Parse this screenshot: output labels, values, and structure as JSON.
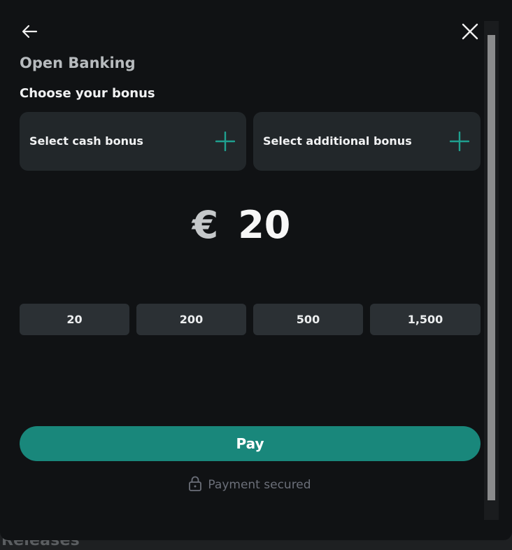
{
  "background": {
    "text": "Releases"
  },
  "modal": {
    "title": "Open Banking",
    "subtitle": "Choose your bonus",
    "bonus_options": [
      {
        "label": "Select cash bonus",
        "icon": "plus-icon"
      },
      {
        "label": "Select additional bonus",
        "icon": "plus-icon"
      }
    ],
    "amount": {
      "currency": "€",
      "value": "20"
    },
    "quick_amounts": [
      "20",
      "200",
      "500",
      "1,500"
    ],
    "pay_label": "Pay",
    "secure_text": "Payment secured",
    "icons": {
      "back": "arrow-left-icon",
      "close": "close-icon",
      "lock": "lock-icon"
    }
  },
  "colors": {
    "accent": "#19877b",
    "plus_icon": "#1fa08f",
    "panel": "#22272a",
    "background": "#101214"
  }
}
